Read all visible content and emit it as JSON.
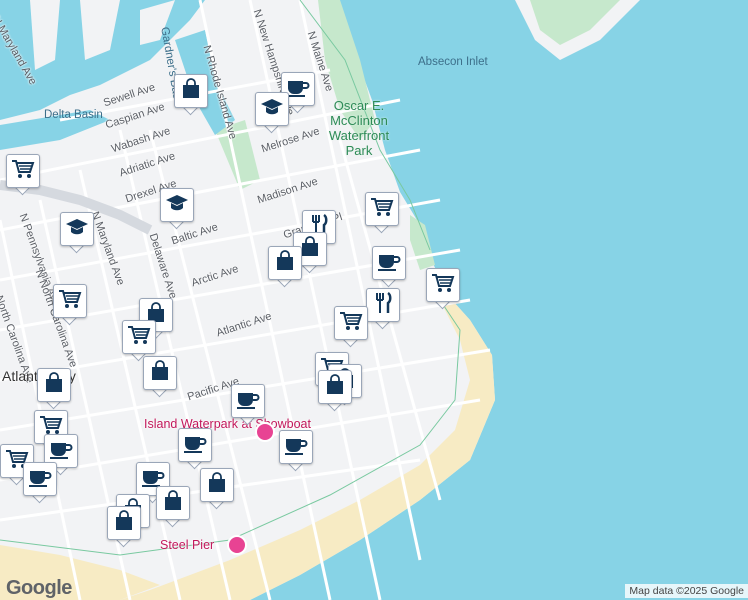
{
  "map": {
    "colors": {
      "water": "#87d3e6",
      "land": "#f2f3f5",
      "beach": "#f7ebc4",
      "park": "#c6e8cc",
      "road": "#ffffff",
      "marker_icon": "#14385a"
    },
    "water_labels": [
      "Absecon Inlet",
      "Delta Basin",
      "Gardner's Basin"
    ],
    "park_label": "Oscar E. McClinton Waterfront Park",
    "poi_labels": [
      "Island Waterpark at Showboat",
      "Steel Pier"
    ],
    "streets": [
      "N Maryland Ave",
      "Sewell Ave",
      "Caspian Ave",
      "Wabash Ave",
      "Adriatic Ave",
      "Drexel Ave",
      "N Rhode Island Ave",
      "N New Hampshire Ave",
      "N Maine Ave",
      "Melrose Ave",
      "Madison Ave",
      "Gramercy Pl",
      "Baltic Ave",
      "Arctic Ave",
      "Atlantic Ave",
      "Pacific Ave",
      "Delaware Ave",
      "N Pennsylvania Ave",
      "N North Carolina Ave",
      "N Maryland Ave",
      "North Carolina Ave",
      "Atlantic City"
    ],
    "marker_types": [
      "shopping-bag-icon",
      "grocery-cart-icon",
      "coffee-cup-icon",
      "graduation-cap-icon",
      "restaurant-icon"
    ],
    "logo": "Google",
    "attribution": "Map data ©2025 Google"
  }
}
